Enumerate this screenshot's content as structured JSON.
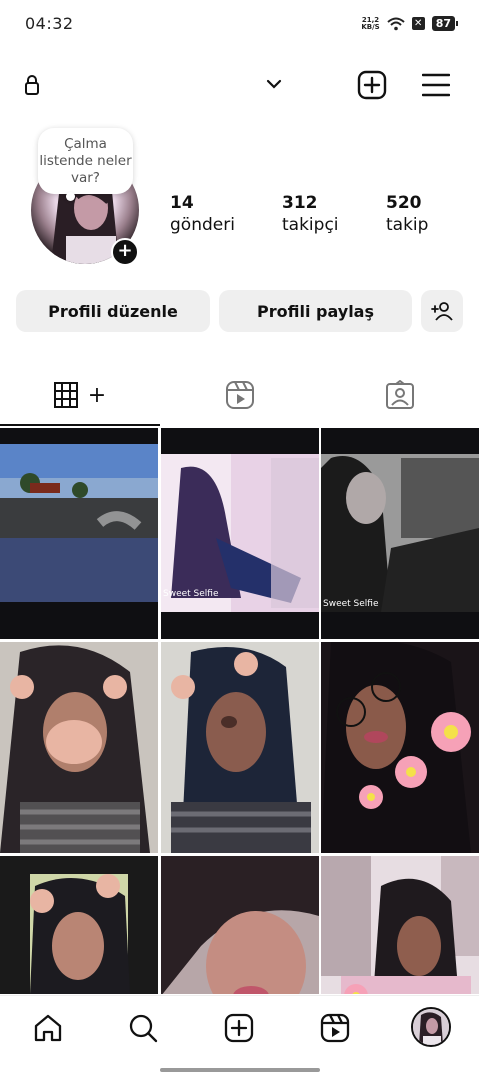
{
  "status_bar": {
    "time": "04:32",
    "net_speed_value": "21,2",
    "net_speed_unit": "KB/S",
    "battery": "87",
    "icons": [
      "wifi-icon",
      "x-icon",
      "battery-icon"
    ]
  },
  "top_bar": {
    "username": "",
    "icons": [
      "lock-icon",
      "chevron-down-icon",
      "add-box-icon",
      "menu-icon"
    ]
  },
  "profile": {
    "note_text": "Çalma listende neler var?",
    "stats": [
      {
        "value": "14",
        "label": "gönderi"
      },
      {
        "value": "312",
        "label": "takipçi"
      },
      {
        "value": "520",
        "label": "takip"
      }
    ]
  },
  "actions": {
    "edit_profile": "Profili düzenle",
    "share_profile": "Profili paylaş"
  },
  "tabs": {
    "grid_plus": "+",
    "items": [
      "grid-icon",
      "reels-icon",
      "tagged-icon"
    ]
  },
  "grid": {
    "watermark_1": "Sweet Selfie",
    "watermark_2": "Sweet Selfie"
  },
  "bottom_nav": [
    "home-icon",
    "search-icon",
    "create-icon",
    "reels-icon",
    "profile-avatar"
  ]
}
